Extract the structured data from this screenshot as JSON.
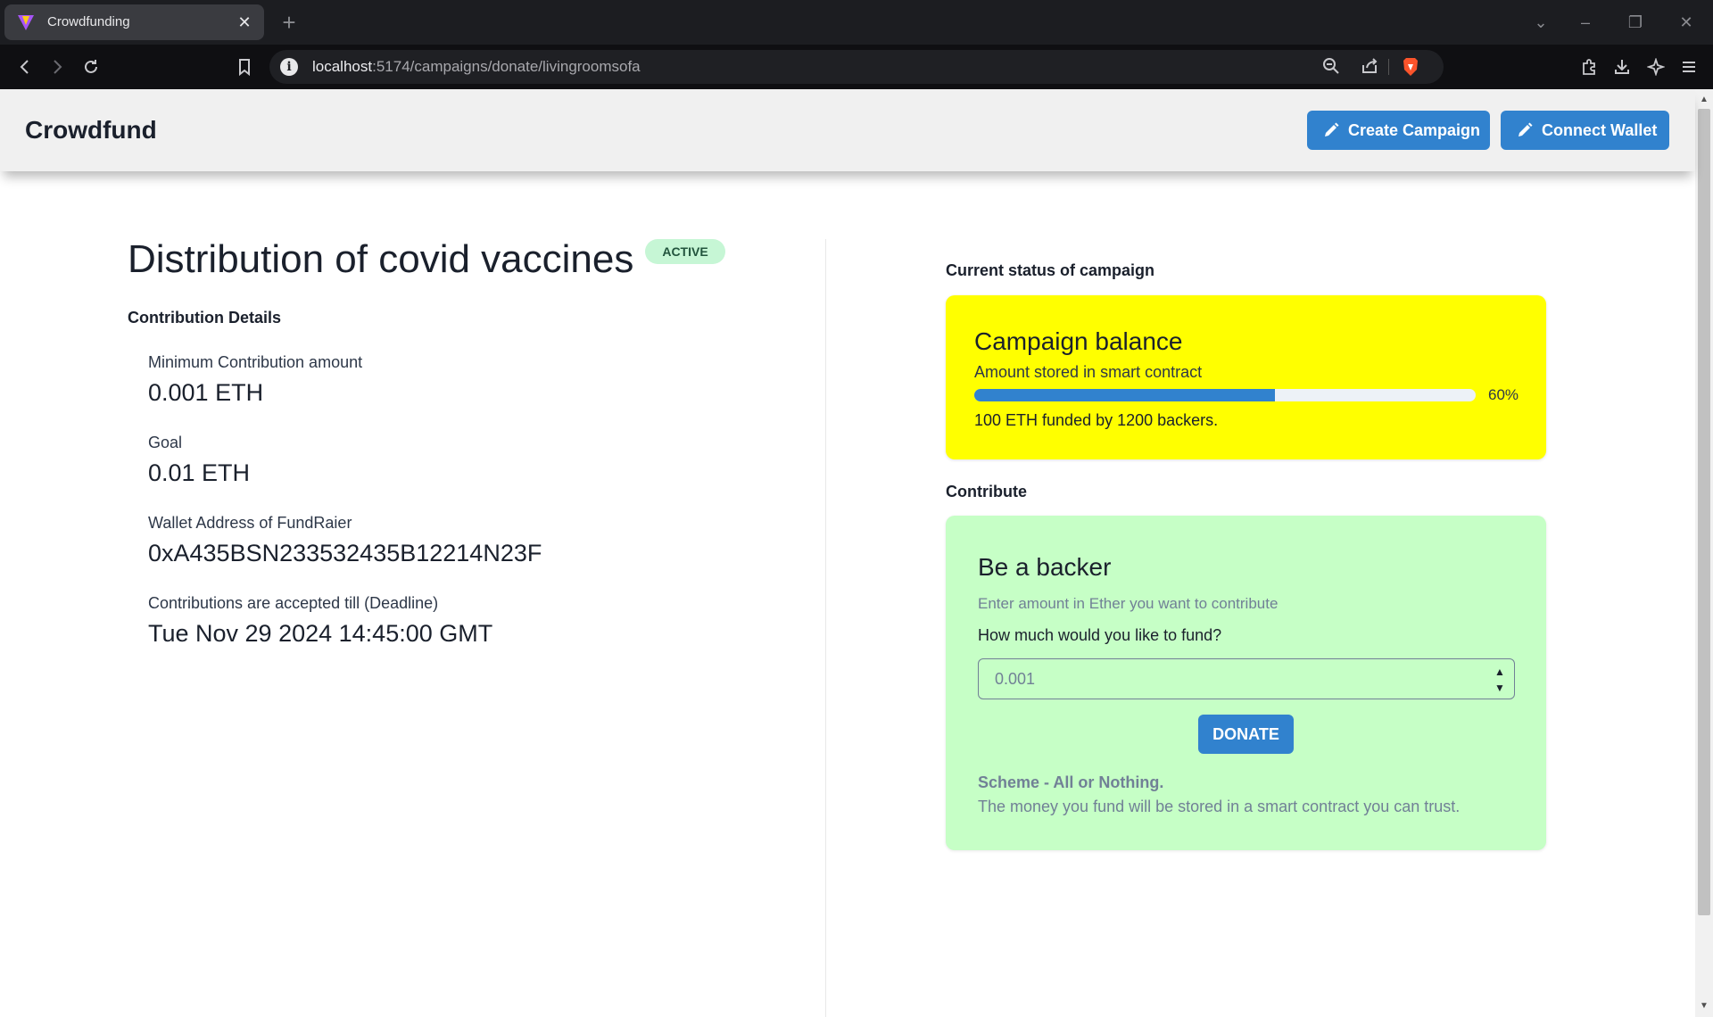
{
  "browser": {
    "tab_title": "Crowdfunding",
    "url_host": "localhost",
    "url_path": ":5174/campaigns/donate/livingroomsofa"
  },
  "header": {
    "brand": "Crowdfund",
    "create_label": "Create Campaign",
    "connect_label": "Connect Wallet"
  },
  "campaign": {
    "title": "Distribution of covid vaccines",
    "status": "ACTIVE",
    "details_heading": "Contribution Details",
    "stats": [
      {
        "label": "Minimum Contribution amount",
        "value": "0.001 ETH"
      },
      {
        "label": "Goal",
        "value": "0.01 ETH"
      },
      {
        "label": "Wallet Address of FundRaier",
        "value": "0xA435BSN233532435B12214N23F"
      },
      {
        "label": "Contributions are accepted till (Deadline)",
        "value": "Tue Nov 29 2024 14:45:00 GMT"
      }
    ]
  },
  "status_section": {
    "heading": "Current status of campaign",
    "card_title": "Campaign balance",
    "card_subtitle": "Amount stored in smart contract",
    "progress": 0.6,
    "progress_label": "60%",
    "funded_text": "100 ETH funded by 1200 backers."
  },
  "contribute": {
    "heading": "Contribute",
    "card_title": "Be a backer",
    "hint": "Enter amount in Ether you want to contribute",
    "question": "How much would you like to fund?",
    "amount_placeholder": "0.001",
    "donate_label": "DONATE",
    "scheme_heading": "Scheme - All or Nothing.",
    "scheme_text": "The money you fund will be stored in a smart contract you can trust."
  },
  "colors": {
    "accent": "#3182ce",
    "balance_card": "#ffff00",
    "backer_card": "#c6ffc6",
    "badge_bg": "#c6f6d5"
  }
}
